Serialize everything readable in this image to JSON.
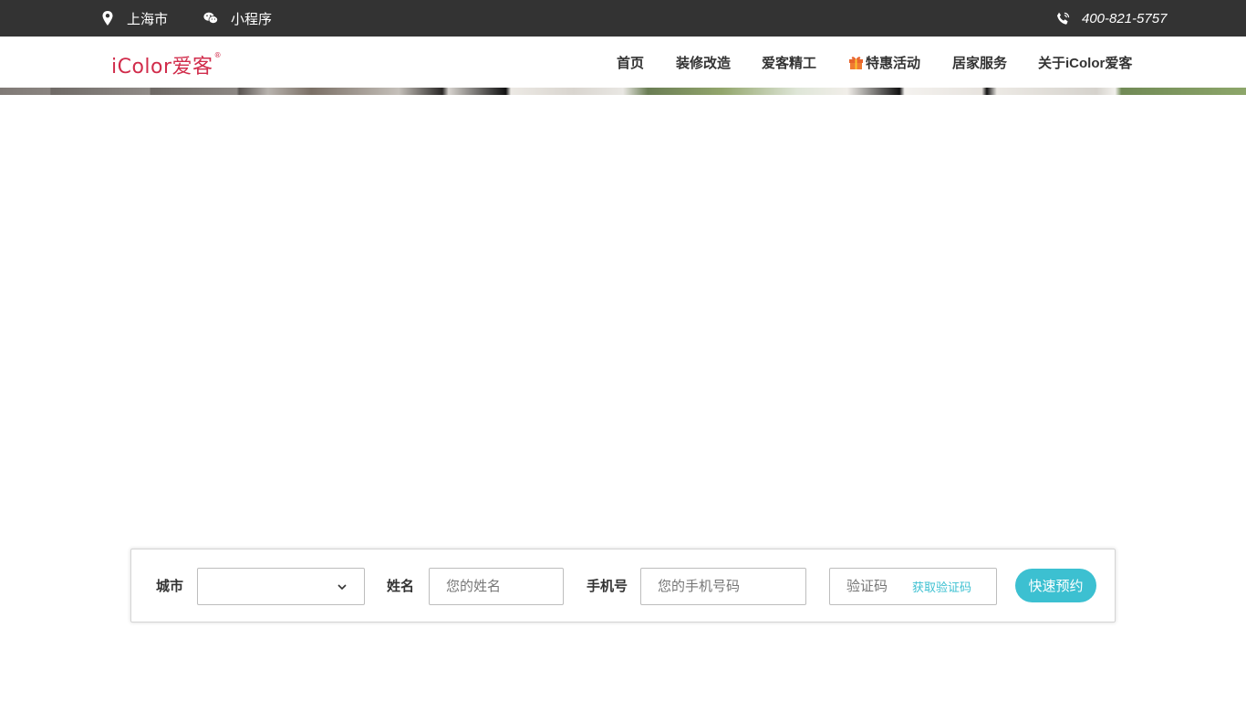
{
  "topbar": {
    "location": "上海市",
    "mini_program": "小程序",
    "phone": "400-821-5757"
  },
  "logo": {
    "text": "iColor爱客",
    "reg_mark": "®",
    "color": "#d12c4b"
  },
  "nav": {
    "items": [
      {
        "label": "首页"
      },
      {
        "label": "装修改造"
      },
      {
        "label": "爱客精工"
      },
      {
        "label": "特惠活动",
        "icon": "gift-icon"
      },
      {
        "label": "居家服务"
      },
      {
        "label": "关于iColor爱客"
      }
    ]
  },
  "booking": {
    "city_label": "城市",
    "city_value": "",
    "name_label": "姓名",
    "name_placeholder": "您的姓名",
    "phone_label": "手机号",
    "phone_placeholder": "您的手机号码",
    "code_placeholder": "验证码",
    "get_code_label": "获取验证码",
    "submit_label": "快速预约",
    "accent_color": "#3cc0d1"
  },
  "colors": {
    "topbar_bg": "#333333",
    "brand": "#d12c4b",
    "accent": "#3cc0d1"
  }
}
